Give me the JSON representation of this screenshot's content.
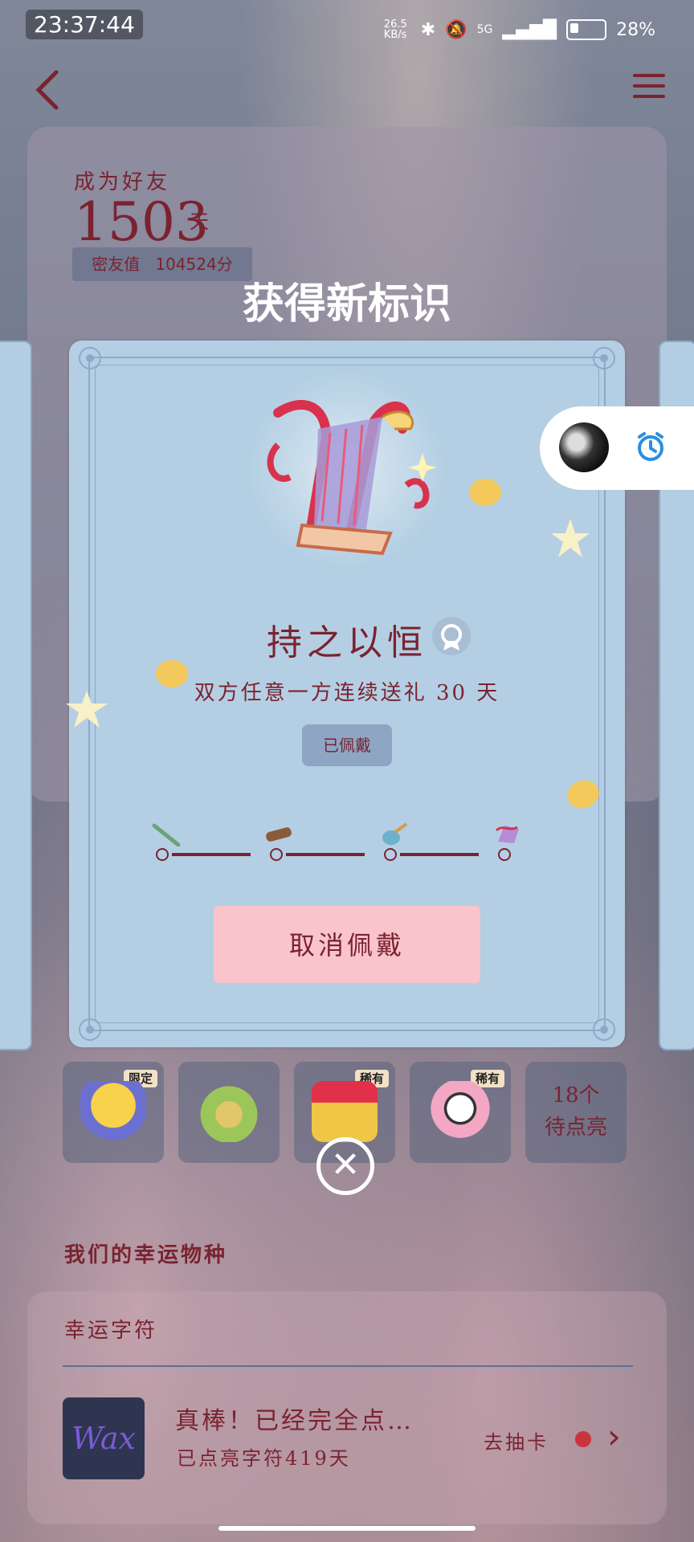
{
  "status_bar": {
    "time": "23:37:44",
    "net_speed": "26.5 KB/s",
    "battery": "28%",
    "signal": "5G"
  },
  "nav": {
    "back_icon": "chevron-left-icon",
    "menu_icon": "hamburger-icon"
  },
  "friendship": {
    "label": "成为好友",
    "days": "1503",
    "days_unit": "天",
    "intimacy_label": "密友值",
    "intimacy_value": "104524分"
  },
  "popup": {
    "title": "获得新标识",
    "badge_name": "持之以恒",
    "description": "双方任意一方连续送礼 30 天",
    "worn_tag": "已佩戴",
    "cancel_button": "取消佩戴",
    "levels": [
      "flute",
      "zither",
      "pipa",
      "harp"
    ]
  },
  "gifts": [
    {
      "tag": "限定",
      "icon": "duck-gift-icon"
    },
    {
      "tag": "",
      "icon": "avocado-frog-icon"
    },
    {
      "tag": "稀有",
      "icon": "heart-giftbox-icon"
    },
    {
      "tag": "稀有",
      "icon": "dog-donut-icon"
    }
  ],
  "gifts_more": {
    "line1": "18个",
    "line2": "待点亮"
  },
  "lucky": {
    "section_title": "我们的幸运物种",
    "card_title": "幸运字符",
    "thumb_text": "Wax",
    "main_text": "真棒！已经完全点…",
    "sub_text": "已点亮字符419天",
    "link_text": "去抽卡"
  },
  "colors": {
    "accent": "#7a2330",
    "dialog_bg": "#b4cfe3",
    "button_bg": "#f9c4cb"
  }
}
